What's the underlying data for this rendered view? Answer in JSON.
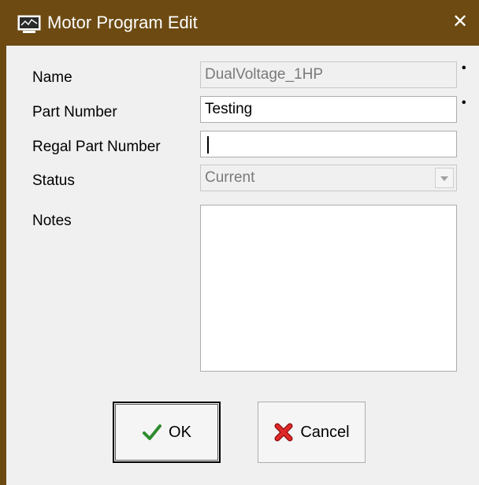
{
  "window": {
    "title": "Motor Program Edit",
    "close_glyph": "✕",
    "icon": "monitor-icon",
    "accent_color": "#6c4a12"
  },
  "form": {
    "name": {
      "label": "Name",
      "value": "DualVoltage_1HP",
      "required_mark": "•",
      "enabled": false
    },
    "part_number": {
      "label": "Part Number",
      "value": "Testing",
      "required_mark": "•"
    },
    "regal_part_number": {
      "label": "Regal Part Number",
      "value": ""
    },
    "status": {
      "label": "Status",
      "value": "Current",
      "enabled": false
    },
    "notes": {
      "label": "Notes",
      "value": ""
    }
  },
  "buttons": {
    "ok": {
      "label": "OK",
      "icon": "checkmark-icon",
      "color": "#2e8b2e"
    },
    "cancel": {
      "label": "Cancel",
      "icon": "red-x-icon",
      "color": "#d42020"
    }
  }
}
